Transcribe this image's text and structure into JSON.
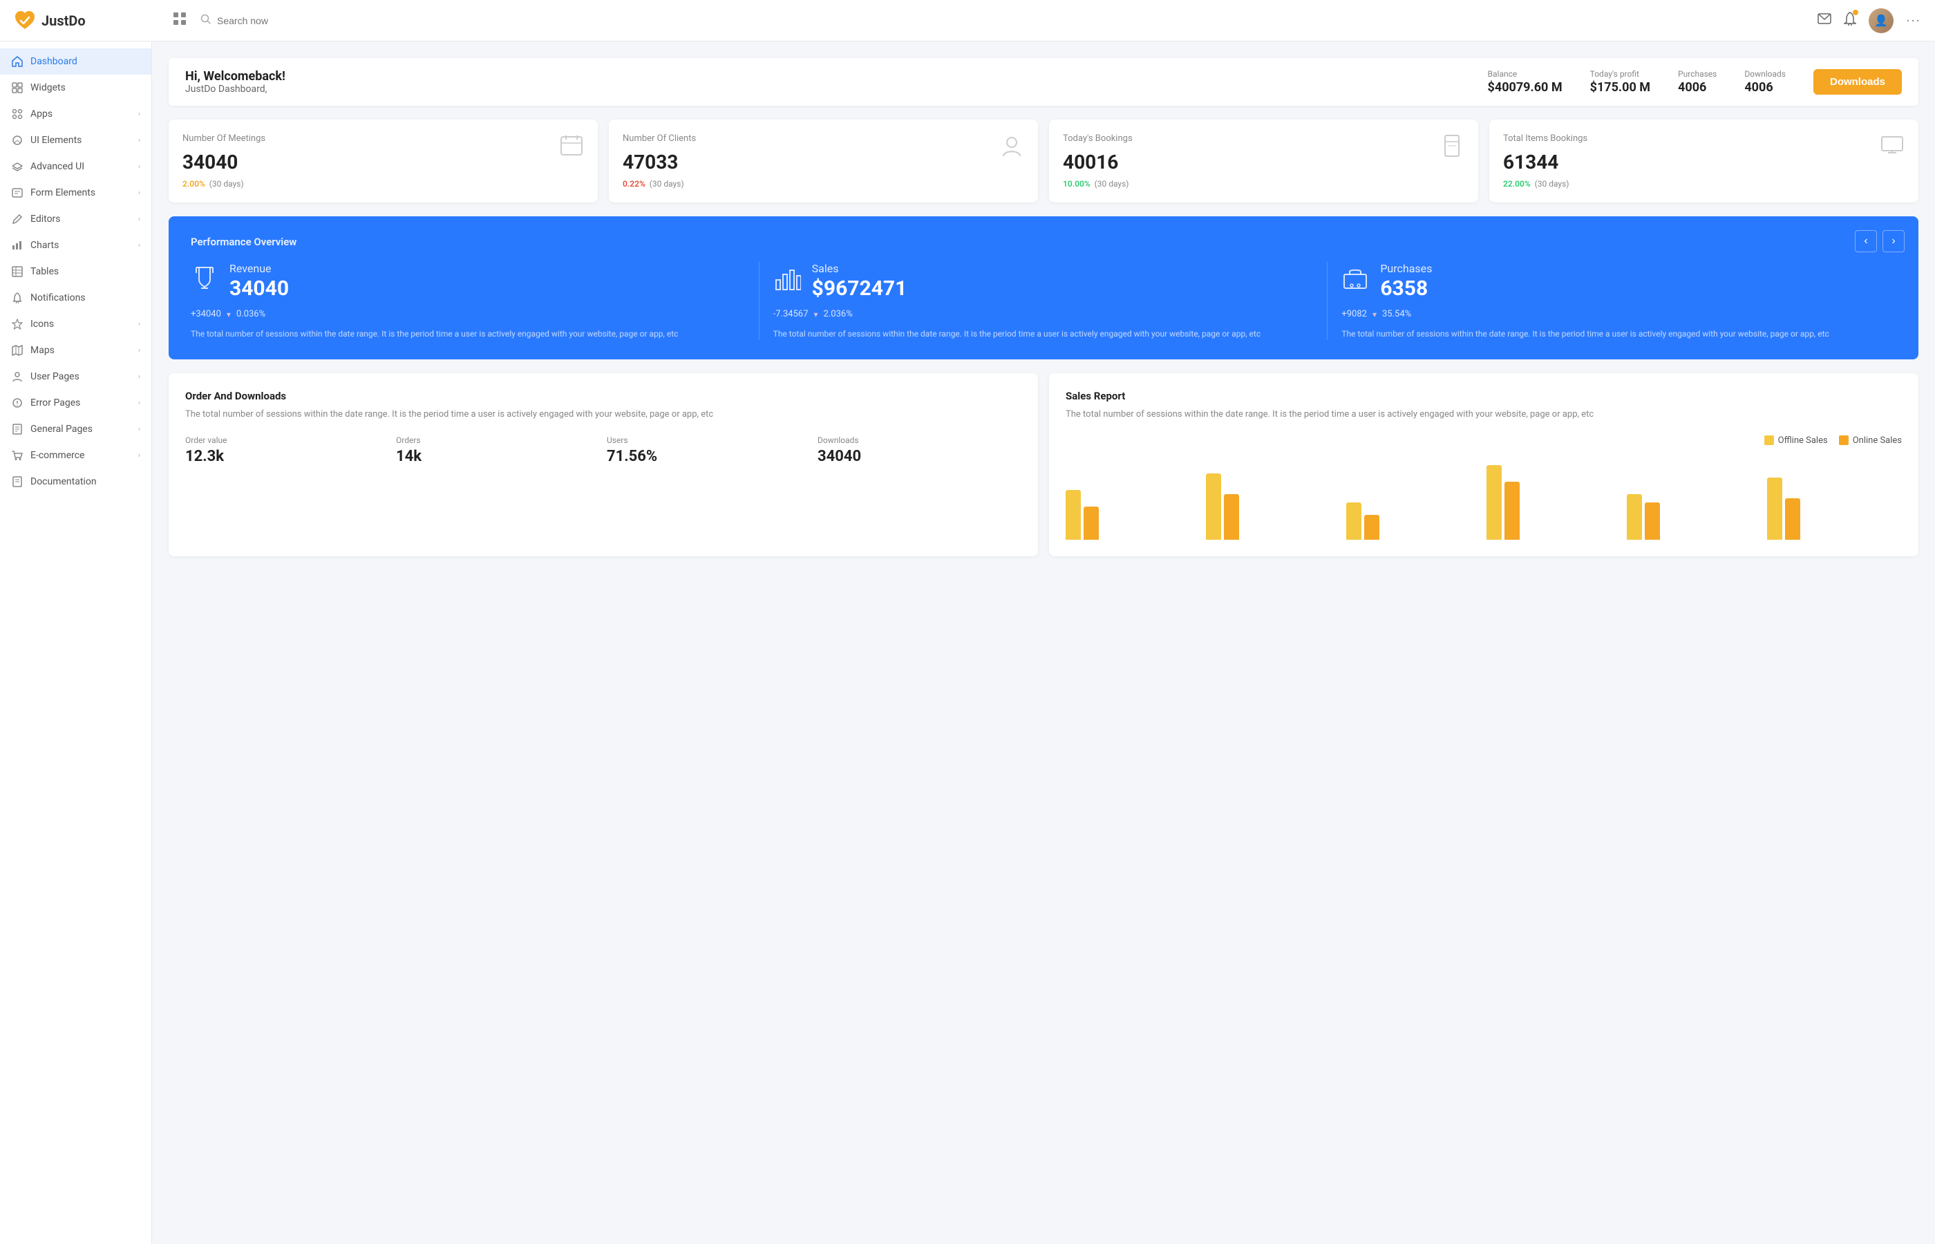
{
  "app": {
    "name": "JustDo",
    "logo_color": "#f5a623"
  },
  "topnav": {
    "search_placeholder": "Search now",
    "dots": "···"
  },
  "sidebar": {
    "items": [
      {
        "id": "dashboard",
        "label": "Dashboard",
        "icon": "home",
        "active": true,
        "has_children": false
      },
      {
        "id": "widgets",
        "label": "Widgets",
        "icon": "widget",
        "active": false,
        "has_children": false
      },
      {
        "id": "apps",
        "label": "Apps",
        "icon": "apps",
        "active": false,
        "has_children": true
      },
      {
        "id": "ui-elements",
        "label": "UI Elements",
        "icon": "palette",
        "active": false,
        "has_children": true
      },
      {
        "id": "advanced-ui",
        "label": "Advanced UI",
        "icon": "layers",
        "active": false,
        "has_children": true
      },
      {
        "id": "form-elements",
        "label": "Form Elements",
        "icon": "form",
        "active": false,
        "has_children": true
      },
      {
        "id": "editors",
        "label": "Editors",
        "icon": "edit",
        "active": false,
        "has_children": true
      },
      {
        "id": "charts",
        "label": "Charts",
        "icon": "chart",
        "active": false,
        "has_children": true
      },
      {
        "id": "tables",
        "label": "Tables",
        "icon": "table",
        "active": false,
        "has_children": false
      },
      {
        "id": "notifications",
        "label": "Notifications",
        "icon": "bell",
        "active": false,
        "has_children": false
      },
      {
        "id": "icons",
        "label": "Icons",
        "icon": "star",
        "active": false,
        "has_children": true
      },
      {
        "id": "maps",
        "label": "Maps",
        "icon": "map",
        "active": false,
        "has_children": true
      },
      {
        "id": "user-pages",
        "label": "User Pages",
        "icon": "user",
        "active": false,
        "has_children": true
      },
      {
        "id": "error-pages",
        "label": "Error Pages",
        "icon": "error",
        "active": false,
        "has_children": true
      },
      {
        "id": "general-pages",
        "label": "General Pages",
        "icon": "pages",
        "active": false,
        "has_children": true
      },
      {
        "id": "e-commerce",
        "label": "E-commerce",
        "icon": "shop",
        "active": false,
        "has_children": true
      },
      {
        "id": "documentation",
        "label": "Documentation",
        "icon": "doc",
        "active": false,
        "has_children": false
      }
    ]
  },
  "header": {
    "welcome_title": "Hi, Welcomeback!",
    "welcome_subtitle": "JustDo Dashboard,",
    "balance_label": "Balance",
    "balance_value": "$40079.60 M",
    "profit_label": "Today's profit",
    "profit_value": "$175.00 M",
    "purchases_label": "Purchases",
    "purchases_value": "4006",
    "downloads_label": "Downloads",
    "downloads_value": "4006",
    "downloads_btn": "Downloads"
  },
  "metrics": [
    {
      "title": "Number Of Meetings",
      "value": "34040",
      "pct": "2.00%",
      "pct_type": "positive",
      "period": "(30 days)",
      "icon": "calendar"
    },
    {
      "title": "Number Of Clients",
      "value": "47033",
      "pct": "0.22%",
      "pct_type": "negative",
      "period": "(30 days)",
      "icon": "user"
    },
    {
      "title": "Today's Bookings",
      "value": "40016",
      "pct": "10.00%",
      "pct_type": "green",
      "period": "(30 days)",
      "icon": "book"
    },
    {
      "title": "Total Items Bookings",
      "value": "61344",
      "pct": "22.00%",
      "pct_type": "green",
      "period": "(30 days)",
      "icon": "monitor"
    }
  ],
  "performance": {
    "title": "Performance Overview",
    "items": [
      {
        "label": "Revenue",
        "value": "34040",
        "sub_pos": "+34040",
        "sub_pct": "0.036%",
        "sub_dir": "down",
        "desc": "The total number of sessions within the date range. It is the period time a user is actively engaged with your website, page or app, etc",
        "icon": "trophy"
      },
      {
        "label": "Sales",
        "value": "$9672471",
        "sub_pos": "-7.34567",
        "sub_pct": "2.036%",
        "sub_dir": "down",
        "desc": "The total number of sessions within the date range. It is the period time a user is actively engaged with your website, page or app, etc",
        "icon": "barchart"
      },
      {
        "label": "Purchases",
        "value": "6358",
        "sub_pos": "+9082",
        "sub_pct": "35.54%",
        "sub_dir": "down",
        "desc": "The total number of sessions within the date range. It is the period time a user is actively engaged with your website, page or app, etc",
        "icon": "cart"
      }
    ]
  },
  "order_downloads": {
    "title": "Order And Downloads",
    "desc": "The total number of sessions within the date range. It is the period time a user is actively engaged with your website, page or app, etc",
    "stats": [
      {
        "label": "Order value",
        "value": "12.3k"
      },
      {
        "label": "Orders",
        "value": "14k"
      },
      {
        "label": "Users",
        "value": "71.56%"
      },
      {
        "label": "Downloads",
        "value": "34040"
      }
    ]
  },
  "sales_report": {
    "title": "Sales Report",
    "desc": "The total number of sessions within the date range. It is the period time a user is actively engaged with your website, page or app, etc",
    "legend": [
      {
        "label": "Offline Sales",
        "color": "#f5c842"
      },
      {
        "label": "Online Sales",
        "color": "#f5a623"
      }
    ],
    "bars": [
      {
        "offline": 60,
        "online": 40
      },
      {
        "offline": 80,
        "online": 55
      },
      {
        "offline": 45,
        "online": 30
      },
      {
        "offline": 90,
        "online": 70
      },
      {
        "offline": 55,
        "online": 45
      },
      {
        "offline": 75,
        "online": 50
      }
    ]
  }
}
